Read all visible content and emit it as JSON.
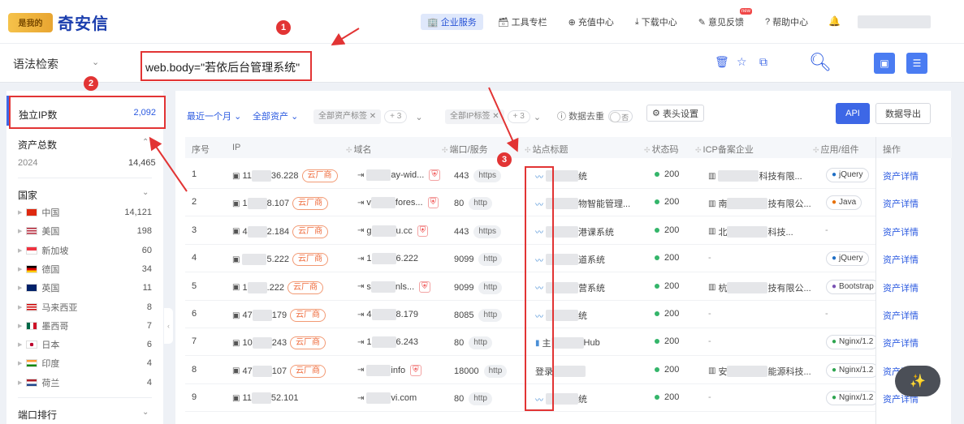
{
  "logo": {
    "mark": "是我的",
    "text": "奇安信"
  },
  "nav": [
    {
      "icon": "🏢",
      "label": "企业服务",
      "active": true
    },
    {
      "icon": "🗃",
      "label": "工具专栏"
    },
    {
      "icon": "⊕",
      "label": "充值中心"
    },
    {
      "icon": "⤓",
      "label": "下载中心"
    },
    {
      "icon": "✎",
      "label": "意见反馈",
      "badge": "new"
    },
    {
      "icon": "?",
      "label": "帮助中心"
    }
  ],
  "search": {
    "syntax_label": "语法检索",
    "query": "web.body=\"若依后台管理系统\""
  },
  "markers": [
    "1",
    "2",
    "3"
  ],
  "sidebar": {
    "ip_label": "独立IP数",
    "ip_value": "2,092",
    "asset_label": "资产总数",
    "asset_year": "2024",
    "asset_value": "14,465",
    "country_label": "国家",
    "countries": [
      {
        "name": "中国",
        "value": "14,121"
      },
      {
        "name": "美国",
        "value": "198"
      },
      {
        "name": "新加坡",
        "value": "60"
      },
      {
        "name": "德国",
        "value": "34"
      },
      {
        "name": "英国",
        "value": "11"
      },
      {
        "name": "马来西亚",
        "value": "8"
      },
      {
        "name": "墨西哥",
        "value": "7"
      },
      {
        "name": "日本",
        "value": "6"
      },
      {
        "name": "印度",
        "value": "4"
      },
      {
        "name": "荷兰",
        "value": "4"
      }
    ],
    "port_label": "端口排行"
  },
  "filters": {
    "recent": "最近一个月",
    "all_assets": "全部资产",
    "asset_tags": "全部资产标签",
    "asset_tags_more": "+ 3",
    "ip_tags": "全部IP标签",
    "ip_tags_more": "+ 3",
    "dedupe": "数据去重",
    "dedupe_state": "否",
    "col_settings": "表头设置",
    "api": "API",
    "export": "数据导出"
  },
  "table": {
    "headers": {
      "idx": "序号",
      "ip": "IP",
      "domain": "域名",
      "port": "端口/服务",
      "title": "站点标题",
      "status": "状态码",
      "icp": "ICP备案企业",
      "app": "应用/组件",
      "ops": "操作"
    },
    "rows": [
      {
        "idx": "1",
        "ip_a": "11",
        "ip_b": "36.228",
        "cloud": "云厂商",
        "dom_a": "",
        "dom_b": "ay-wid...",
        "shield": true,
        "port": "443",
        "proto": "https",
        "title_a": "",
        "title_b": "统",
        "status": "200",
        "icp_b": "科技有限...",
        "app": "jQuery",
        "op": "资产详情"
      },
      {
        "idx": "2",
        "ip_a": "1",
        "ip_b": "8.107",
        "cloud": "云厂商",
        "dom_a": "v",
        "dom_b": "fores...",
        "shield": true,
        "port": "80",
        "proto": "http",
        "title_a": "",
        "title_b": "物智能管理...",
        "status": "200",
        "icp_a": "南",
        "icp_b": "技有限公...",
        "app": "Java",
        "op": "资产详情"
      },
      {
        "idx": "3",
        "ip_a": "4",
        "ip_b": "2.184",
        "cloud": "云厂商",
        "dom_a": "g",
        "dom_b": "u.cc",
        "shield": true,
        "port": "443",
        "proto": "https",
        "title_a": "",
        "title_b": "港课系统",
        "status": "200",
        "icp_a": "北",
        "icp_b": "科技...",
        "app": "-",
        "op": "资产详情"
      },
      {
        "idx": "4",
        "ip_a": "",
        "ip_b": "5.222",
        "cloud": "云厂商",
        "dom_a": "1",
        "dom_b": "6.222",
        "shield": false,
        "port": "9099",
        "proto": "http",
        "title_a": "",
        "title_b": "道系统",
        "status": "200",
        "icp_b": "-",
        "app": "jQuery",
        "op": "资产详情"
      },
      {
        "idx": "5",
        "ip_a": "1",
        "ip_b": ".222",
        "cloud": "云厂商",
        "dom_a": "s",
        "dom_b": "nls...",
        "shield": true,
        "port": "9099",
        "proto": "http",
        "title_a": "",
        "title_b": "营系统",
        "status": "200",
        "icp_a": "杭",
        "icp_b": "技有限公...",
        "app": "Bootstrap",
        "op": "资产详情"
      },
      {
        "idx": "6",
        "ip_a": "47",
        "ip_b": "179",
        "cloud": "云厂商",
        "dom_a": "4",
        "dom_b": "8.179",
        "shield": false,
        "port": "8085",
        "proto": "http",
        "title_a": "",
        "title_b": "统",
        "status": "200",
        "icp_b": "-",
        "app": "-",
        "op": "资产详情"
      },
      {
        "idx": "7",
        "ip_a": "10",
        "ip_b": "243",
        "cloud": "云厂商",
        "dom_a": "1",
        "dom_b": "6.243",
        "shield": false,
        "port": "80",
        "proto": "http",
        "title_a": "主",
        "title_b": "Hub",
        "status": "200",
        "icp_b": "-",
        "app": "Nginx/1.2",
        "op": "资产详情"
      },
      {
        "idx": "8",
        "ip_a": "47",
        "ip_b": "107",
        "cloud": "云厂商",
        "dom_a": "",
        "dom_b": "info",
        "shield": true,
        "port": "18000",
        "proto": "http",
        "title_a": "登录",
        "title_b": "",
        "status": "200",
        "icp_a": "安",
        "icp_b": "能源科技...",
        "app": "Nginx/1.2",
        "op": "资产详情"
      },
      {
        "idx": "9",
        "ip_a": "11",
        "ip_b": "52.101",
        "cloud": "",
        "dom_a": "",
        "dom_b": "vi.com",
        "shield": false,
        "port": "80",
        "proto": "http",
        "title_a": "",
        "title_b": "统",
        "status": "200",
        "icp_b": "-",
        "app": "Nginx/1.2",
        "op": "资产详情"
      }
    ]
  },
  "colors": {
    "accent": "#3d67e6",
    "highlight": "#e23434",
    "ok": "#34b56a",
    "cloud": "#ef6c3d"
  }
}
